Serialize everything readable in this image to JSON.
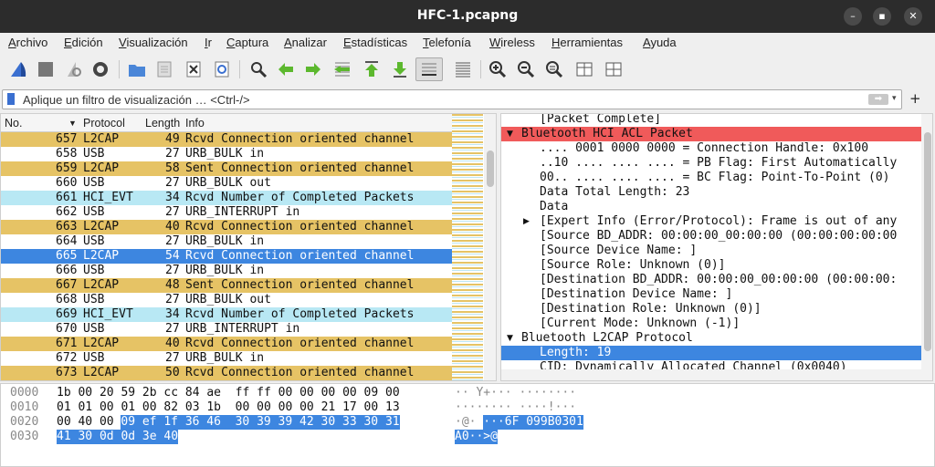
{
  "window": {
    "title": "HFC-1.pcapng"
  },
  "menu": [
    "Archivo",
    "Edición",
    "Visualización",
    "Ir",
    "Captura",
    "Analizar",
    "Estadísticas",
    "Telefonía",
    "Wireless",
    "Herramientas",
    "Ayuda"
  ],
  "filter": {
    "placeholder": "Aplique un filtro de visualización … <Ctrl-/>",
    "plus": "+"
  },
  "packet_list": {
    "headers": [
      "No.",
      "Protocol",
      "Length",
      "Info"
    ],
    "rows": [
      {
        "no": "657",
        "proto": "L2CAP",
        "len": "49",
        "info": "Rcvd Connection oriented channel",
        "color": "#e6c365"
      },
      {
        "no": "658",
        "proto": "USB",
        "len": "27",
        "info": "URB_BULK in",
        "color": "#ffffff"
      },
      {
        "no": "659",
        "proto": "L2CAP",
        "len": "58",
        "info": "Sent Connection oriented channel",
        "color": "#e6c365"
      },
      {
        "no": "660",
        "proto": "USB",
        "len": "27",
        "info": "URB_BULK out",
        "color": "#ffffff"
      },
      {
        "no": "661",
        "proto": "HCI_EVT",
        "len": "34",
        "info": "Rcvd Number of Completed Packets",
        "color": "#b8e8f4"
      },
      {
        "no": "662",
        "proto": "USB",
        "len": "27",
        "info": "URB_INTERRUPT in",
        "color": "#ffffff"
      },
      {
        "no": "663",
        "proto": "L2CAP",
        "len": "40",
        "info": "Rcvd Connection oriented channel",
        "color": "#e6c365"
      },
      {
        "no": "664",
        "proto": "USB",
        "len": "27",
        "info": "URB_BULK in",
        "color": "#ffffff"
      },
      {
        "no": "665",
        "proto": "L2CAP",
        "len": "54",
        "info": "Rcvd Connection oriented channel",
        "color": "#3d86e0",
        "selected": true
      },
      {
        "no": "666",
        "proto": "USB",
        "len": "27",
        "info": "URB_BULK in",
        "color": "#ffffff"
      },
      {
        "no": "667",
        "proto": "L2CAP",
        "len": "48",
        "info": "Sent Connection oriented channel",
        "color": "#e6c365"
      },
      {
        "no": "668",
        "proto": "USB",
        "len": "27",
        "info": "URB_BULK out",
        "color": "#ffffff"
      },
      {
        "no": "669",
        "proto": "HCI_EVT",
        "len": "34",
        "info": "Rcvd Number of Completed Packets",
        "color": "#b8e8f4"
      },
      {
        "no": "670",
        "proto": "USB",
        "len": "27",
        "info": "URB_INTERRUPT in",
        "color": "#ffffff"
      },
      {
        "no": "671",
        "proto": "L2CAP",
        "len": "40",
        "info": "Rcvd Connection oriented channel",
        "color": "#e6c365"
      },
      {
        "no": "672",
        "proto": "USB",
        "len": "27",
        "info": "URB_BULK in",
        "color": "#ffffff"
      },
      {
        "no": "673",
        "proto": "L2CAP",
        "len": "50",
        "info": "Rcvd Connection oriented channel",
        "color": "#e6c365"
      }
    ]
  },
  "details": {
    "rows": [
      {
        "text": "[Packet Complete]",
        "indent": 2,
        "arrow": ""
      },
      {
        "text": "Bluetooth HCI ACL Packet",
        "indent": 1,
        "arrow": "down",
        "color": "#f05a5a"
      },
      {
        "text": ".... 0001 0000 0000 = Connection Handle: 0x100",
        "indent": 2,
        "arrow": ""
      },
      {
        "text": "..10 .... .... .... = PB Flag: First Automatically",
        "indent": 2,
        "arrow": ""
      },
      {
        "text": "00.. .... .... .... = BC Flag: Point-To-Point (0)",
        "indent": 2,
        "arrow": ""
      },
      {
        "text": "Data Total Length: 23",
        "indent": 2,
        "arrow": ""
      },
      {
        "text": "Data",
        "indent": 2,
        "arrow": ""
      },
      {
        "text": "[Expert Info (Error/Protocol): Frame is out of any",
        "indent": 2,
        "arrow": "right"
      },
      {
        "text": "[Source BD_ADDR: 00:00:00_00:00:00 (00:00:00:00:00",
        "indent": 2,
        "arrow": ""
      },
      {
        "text": "[Source Device Name: ]",
        "indent": 2,
        "arrow": ""
      },
      {
        "text": "[Source Role: Unknown (0)]",
        "indent": 2,
        "arrow": ""
      },
      {
        "text": "[Destination BD_ADDR: 00:00:00_00:00:00 (00:00:00:",
        "indent": 2,
        "arrow": ""
      },
      {
        "text": "[Destination Device Name: ]",
        "indent": 2,
        "arrow": ""
      },
      {
        "text": "[Destination Role: Unknown (0)]",
        "indent": 2,
        "arrow": ""
      },
      {
        "text": "[Current Mode: Unknown (-1)]",
        "indent": 2,
        "arrow": ""
      },
      {
        "text": "Bluetooth L2CAP Protocol",
        "indent": 1,
        "arrow": "down"
      },
      {
        "text": "Length: 19",
        "indent": 2,
        "arrow": "",
        "color": "#3d86e0",
        "selected": true
      },
      {
        "text": "CID: Dynamically Allocated Channel (0x0040)",
        "indent": 2,
        "arrow": ""
      }
    ]
  },
  "bytes": {
    "rows": [
      {
        "off": "0000",
        "hex_a": "1b 00 20 59 2b cc 84 ae  ff ff 00 00 00 00 09 00",
        "hex_b": "",
        "ascii_a": "·· Y+··· ········",
        "ascii_b": ""
      },
      {
        "off": "0010",
        "hex_a": "01 01 00 01 00 82 03 1b  00 00 00 00 21 17 00 13",
        "hex_b": "",
        "ascii_a": "········ ····!···",
        "ascii_b": ""
      },
      {
        "off": "0020",
        "hex_a": "00 40 00 ",
        "hex_b": "09 ef 1f 36 46  30 39 39 42 30 33 30 31",
        "ascii_a": "·@· ",
        "ascii_b": "···6F 099B0301"
      },
      {
        "off": "0030",
        "hex_a": "",
        "hex_b": "41 30 0d 0d 3e 40",
        "ascii_a": "",
        "ascii_b": "A0··>@"
      }
    ]
  }
}
